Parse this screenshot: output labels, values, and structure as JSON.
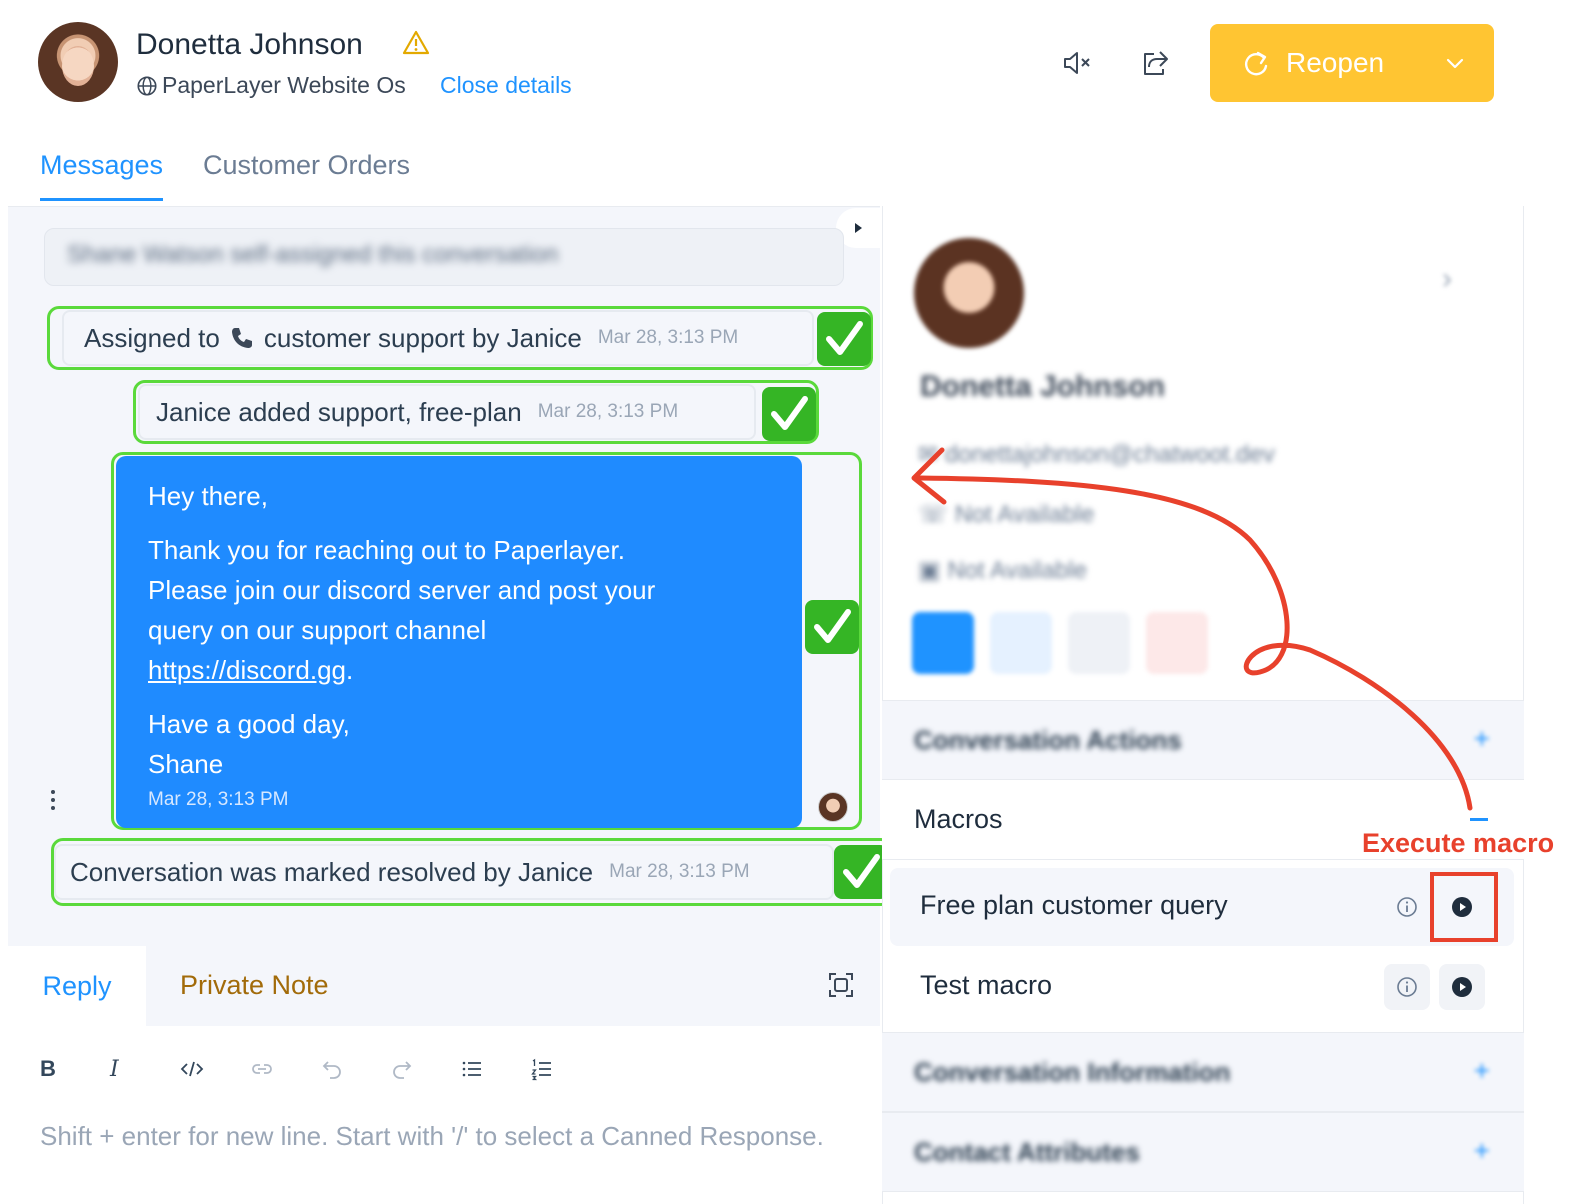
{
  "header": {
    "contact_name": "Donetta Johnson",
    "inbox_name": "PaperLayer Website Os",
    "close_details": "Close details",
    "reopen_label": "Reopen"
  },
  "tabs": [
    {
      "label": "Messages",
      "active": true
    },
    {
      "label": "Customer Orders",
      "active": false
    }
  ],
  "messages": {
    "blurred_activity": "Shane Watson self-assigned this conversation",
    "activity_1": {
      "before_icon": "Assigned to",
      "after_icon": "customer support by Janice",
      "time": "Mar 28, 3:13 PM"
    },
    "activity_2": {
      "text": "Janice added support, free-plan",
      "time": "Mar 28, 3:13 PM"
    },
    "outgoing": {
      "line1": "Hey there,",
      "line2": "Thank you for reaching out to Paperlayer.",
      "line3": "Please join our discord server and post your",
      "line4": "query on our support channel",
      "link": "https://discord.gg",
      "link_suffix": ".",
      "line5": "Have a good day,",
      "line6": "Shane",
      "time": "Mar 28, 3:13 PM"
    },
    "activity_3": {
      "text": "Conversation was marked resolved by Janice",
      "time": "Mar 28, 3:13 PM"
    }
  },
  "reply_box": {
    "reply_tab": "Reply",
    "private_note_tab": "Private Note",
    "bold_label": "B",
    "italic_label": "I",
    "placeholder": "Shift + enter for new line. Start with '/' to select a Canned Response."
  },
  "sidebar": {
    "contact_name": "Donetta Johnson",
    "email": "donettajohnson@chatwoot.dev",
    "phone": "Not Available",
    "company": "Not Available",
    "sections": {
      "conversation_actions": "Conversation Actions",
      "macros": "Macros",
      "conversation_information": "Conversation Information",
      "contact_attributes": "Contact Attributes",
      "expand_symbol": "+"
    },
    "macros": [
      {
        "name": "Free plan customer query"
      },
      {
        "name": "Test macro"
      }
    ]
  },
  "annotation": {
    "label": "Execute macro",
    "color": "#e8412c"
  },
  "colors": {
    "accent": "#1f93ff",
    "reopen": "#ffc532",
    "bubble": "#1f8bff",
    "highlight": "#5ad93b",
    "private_note": "#a26b0a"
  }
}
